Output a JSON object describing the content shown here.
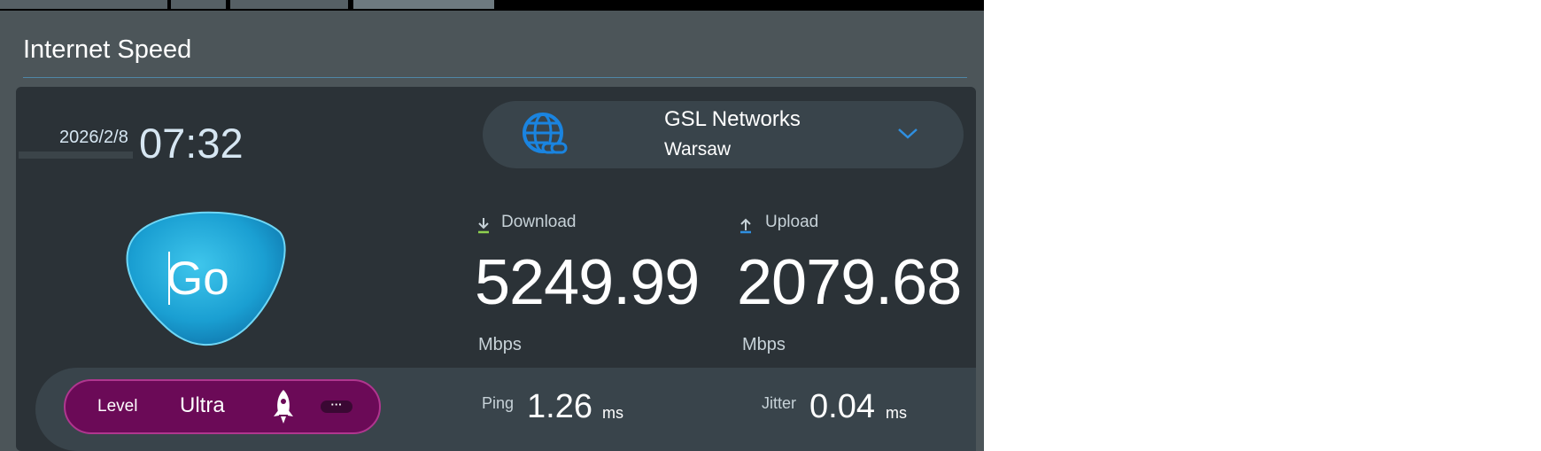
{
  "section": {
    "title": "Internet Speed"
  },
  "clock": {
    "date": "2026/2/8",
    "time": "07:32"
  },
  "server": {
    "name": "GSL Networks",
    "city": "Warsaw",
    "icon": "globe-link-icon"
  },
  "go_button": {
    "label": "Go"
  },
  "download": {
    "label": "Download",
    "value": "5249.99",
    "unit": "Mbps",
    "icon_color": "#8fd14f"
  },
  "upload": {
    "label": "Upload",
    "value": "2079.68",
    "unit": "Mbps",
    "icon_color": "#2f8fe0"
  },
  "level": {
    "label": "Level",
    "value": "Ultra",
    "more": "···"
  },
  "ping": {
    "label": "Ping",
    "value": "1.26",
    "unit": "ms"
  },
  "jitter": {
    "label": "Jitter",
    "value": "0.04",
    "unit": "ms"
  },
  "colors": {
    "accent": "#1a84e0",
    "level_pill": "#6b0a57",
    "go_button": "#1fa3d6"
  }
}
